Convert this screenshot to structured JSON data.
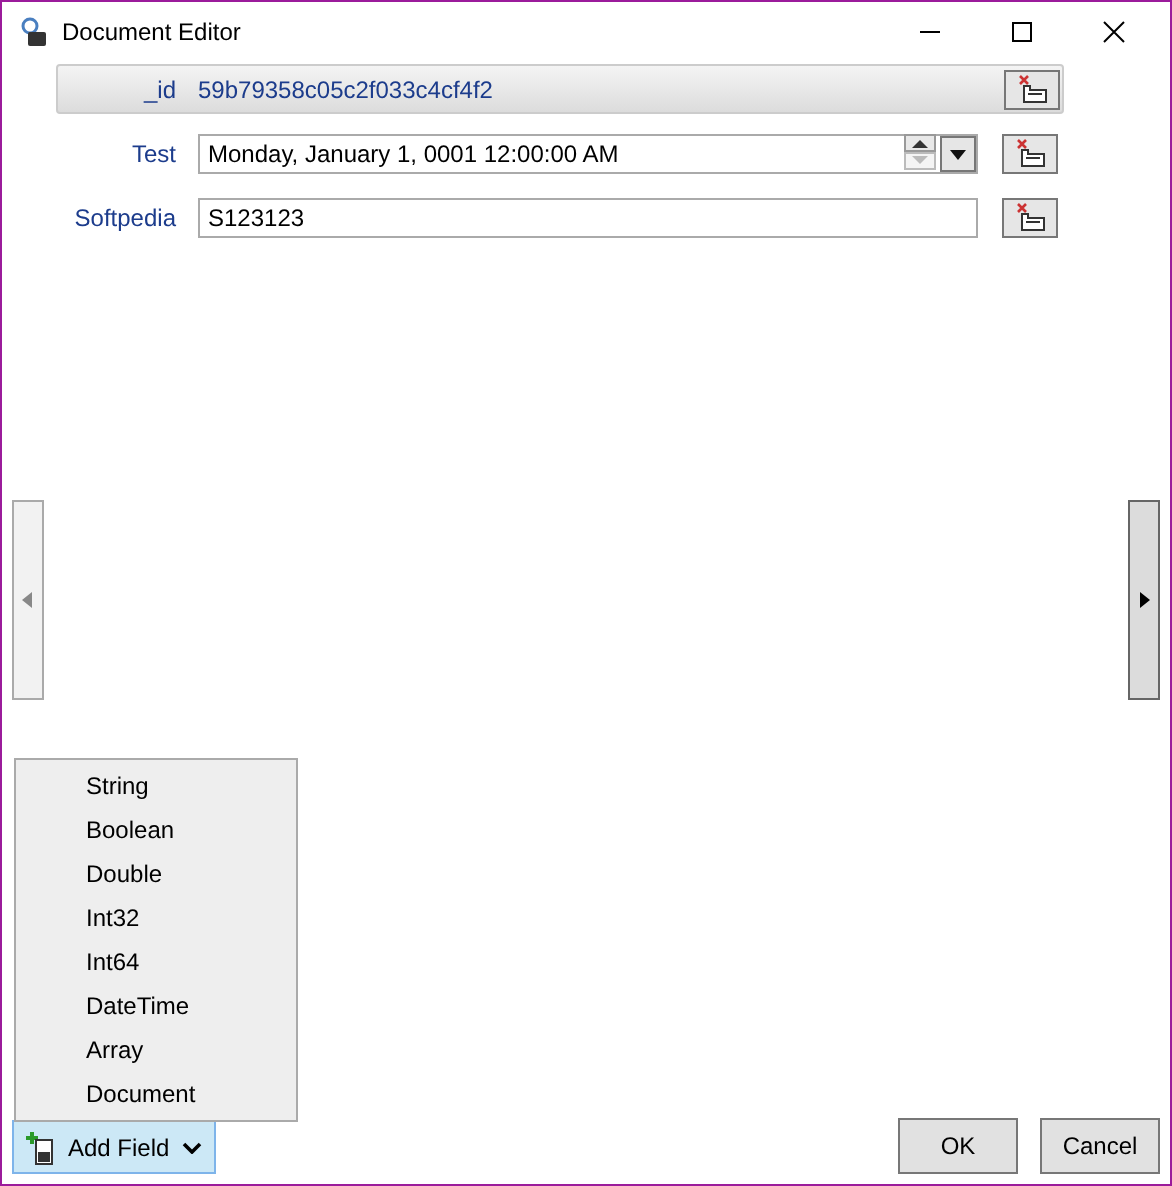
{
  "window": {
    "title": "Document Editor"
  },
  "fields": [
    {
      "name": "_id",
      "value": "59b79358c05c2f033c4cf4f2",
      "kind": "objectid",
      "selected": true
    },
    {
      "name": "Test",
      "value": "Monday, January 1, 0001 12:00:00 AM",
      "kind": "datetime",
      "selected": false
    },
    {
      "name": "Softpedia",
      "value": "S123123",
      "kind": "string",
      "selected": false
    }
  ],
  "add_field": {
    "label": "Add Field",
    "expanded": true,
    "menu": [
      "String",
      "Boolean",
      "Double",
      "Int32",
      "Int64",
      "DateTime",
      "Array",
      "Document"
    ]
  },
  "buttons": [
    "OK",
    "Cancel"
  ]
}
